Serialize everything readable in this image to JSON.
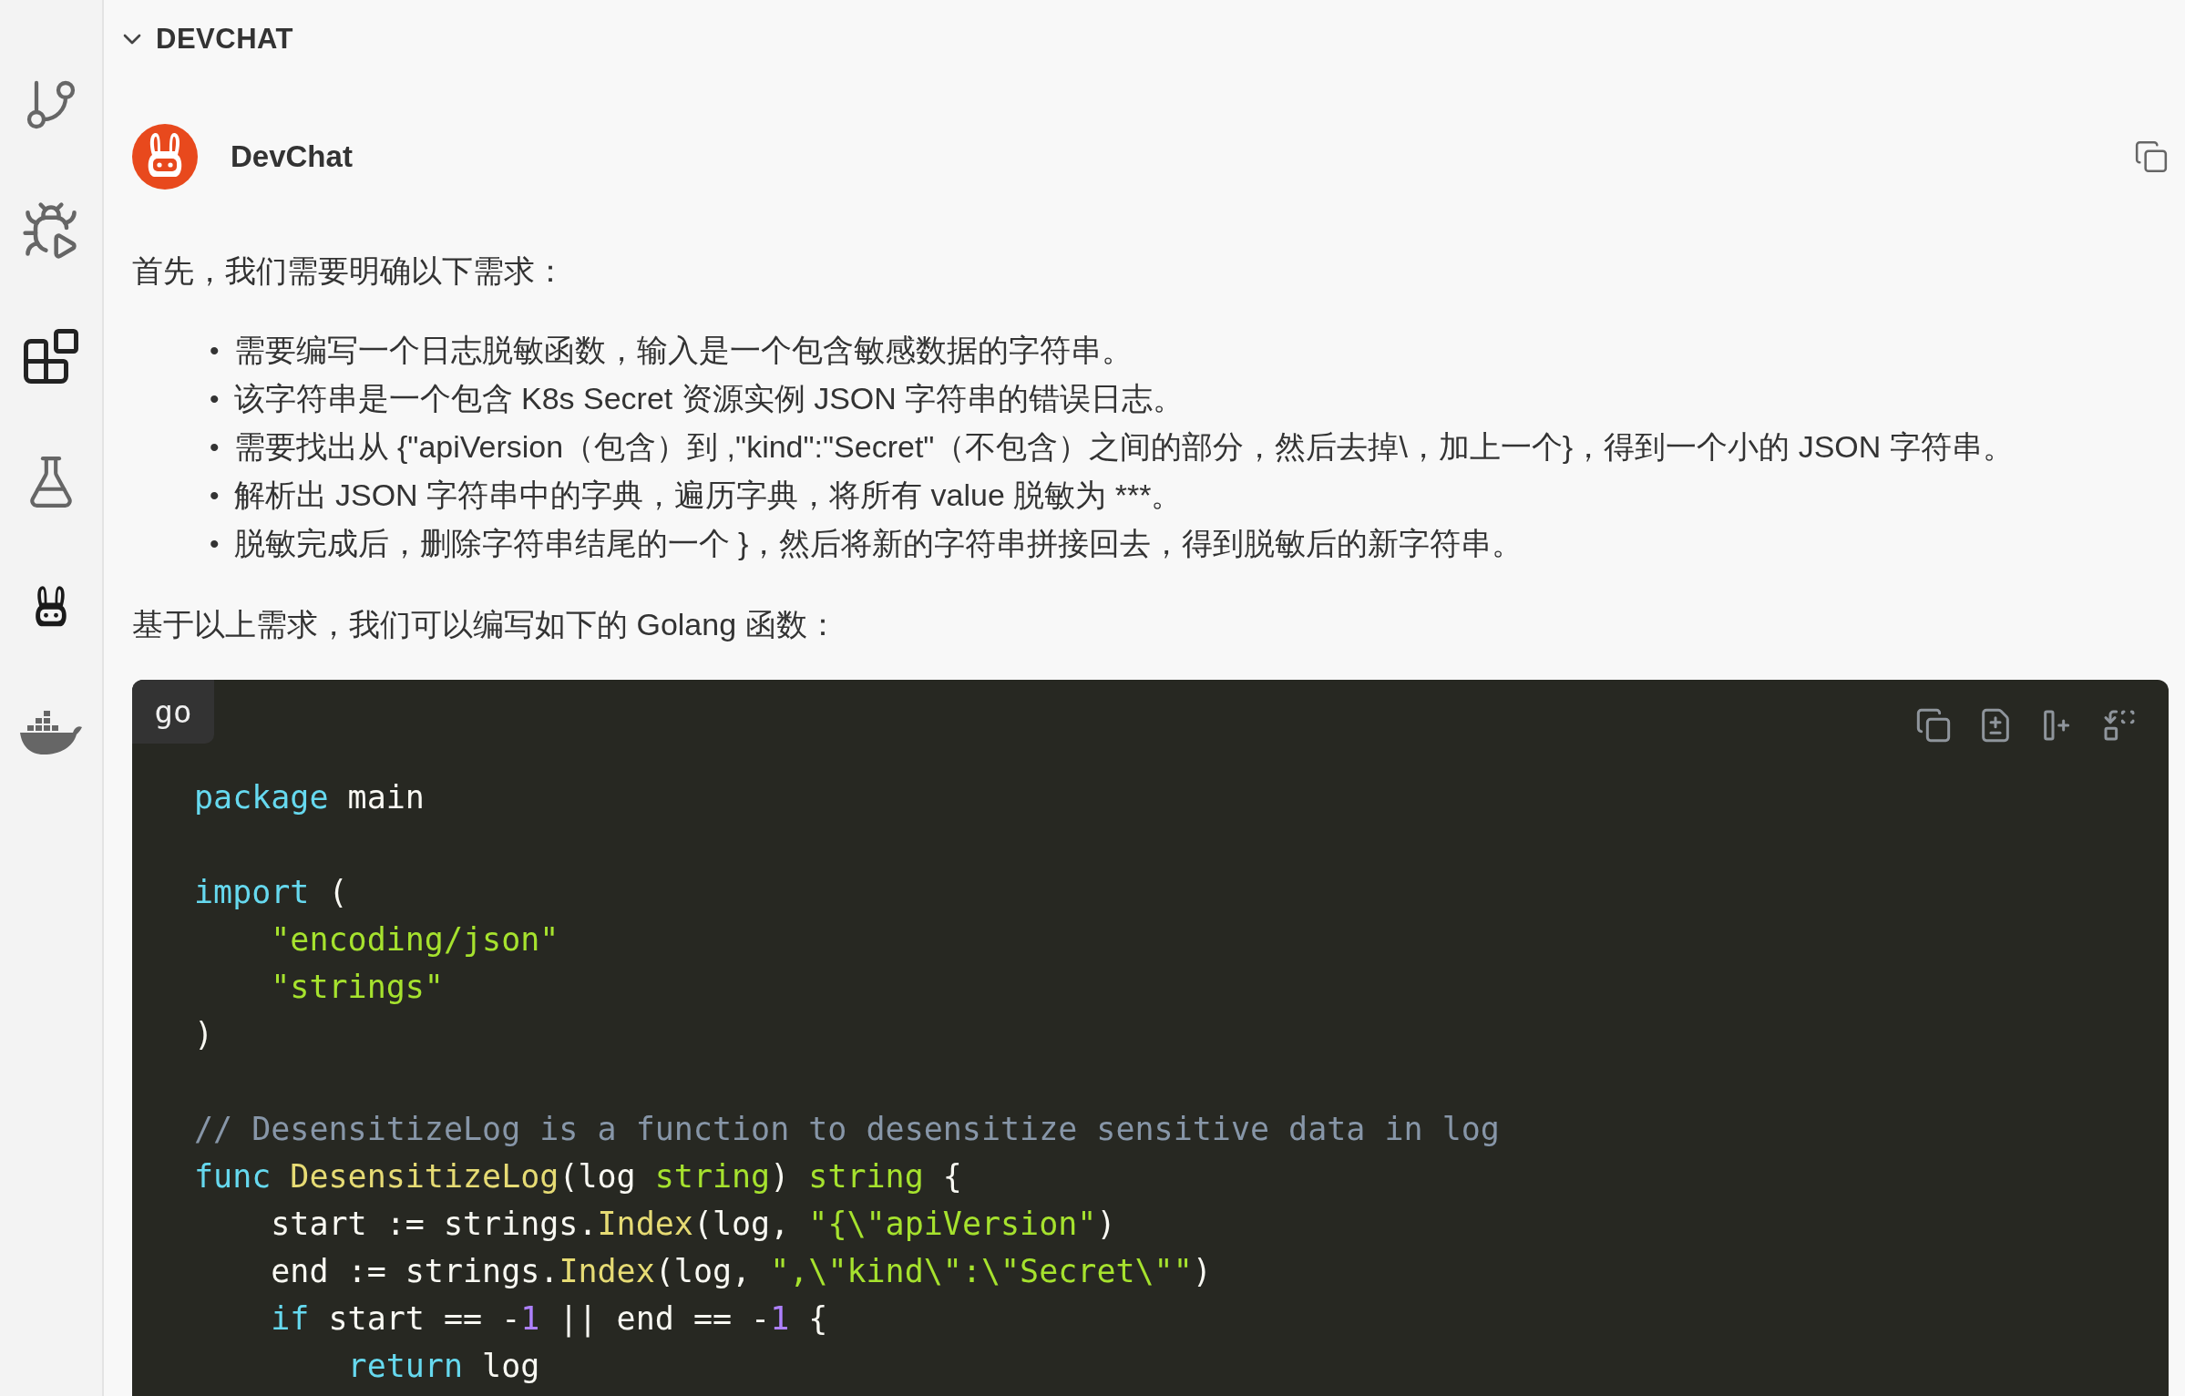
{
  "activity_bar": [
    {
      "kind": "branch"
    },
    {
      "kind": "debug"
    },
    {
      "kind": "extensions"
    },
    {
      "kind": "testing"
    },
    {
      "kind": "devchat"
    },
    {
      "kind": "docker"
    }
  ],
  "panel": {
    "title": "DEVCHAT",
    "expanded": true
  },
  "message": {
    "author": "DevChat",
    "intro": "首先，我们需要明确以下需求：",
    "bullets": [
      {
        "marker": "•",
        "text": "需要编写一个日志脱敏函数，输入是一个包含敏感数据的字符串。"
      },
      {
        "marker": "•",
        "text": "该字符串是一个包含 K8s Secret 资源实例 JSON 字符串的错误日志。"
      },
      {
        "marker": "•",
        "text": "需要找出从 {\"apiVersion（包含）到 ,\"kind\":\"Secret\"（不包含）之间的部分，然后去掉\\，加上一个}，得到一个小的 JSON 字符串。"
      },
      {
        "marker": "•",
        "text": "解析出 JSON 字符串中的字典，遍历字典，将所有 value 脱敏为 ***。"
      },
      {
        "marker": "•",
        "text": "脱敏完成后，删除字符串结尾的一个 }，然后将新的字符串拼接回去，得到脱敏后的新字符串。"
      }
    ],
    "outro": "基于以上需求，我们可以编写如下的 Golang 函数：",
    "code": {
      "language": "go",
      "lines": [
        {
          "kind": "code",
          "tokens": [
            {
              "kind": "keyword",
              "text": "package"
            },
            {
              "kind": "plain",
              "text": " main"
            }
          ]
        },
        {
          "kind": "blank"
        },
        {
          "kind": "code",
          "tokens": [
            {
              "kind": "keyword",
              "text": "import"
            },
            {
              "kind": "plain",
              "text": " ("
            }
          ]
        },
        {
          "kind": "code",
          "tokens": [
            {
              "kind": "string",
              "text": "    \"encoding/json\""
            }
          ]
        },
        {
          "kind": "code",
          "tokens": [
            {
              "kind": "string",
              "text": "    \"strings\""
            }
          ]
        },
        {
          "kind": "code",
          "tokens": [
            {
              "kind": "plain",
              "text": ")"
            }
          ]
        },
        {
          "kind": "blank"
        },
        {
          "kind": "code",
          "tokens": [
            {
              "kind": "comment",
              "text": "// DesensitizeLog is a function to desensitize sensitive data in log"
            }
          ]
        },
        {
          "kind": "code",
          "tokens": [
            {
              "kind": "keyword",
              "text": "func "
            },
            {
              "kind": "func",
              "text": "DesensitizeLog"
            },
            {
              "kind": "plain",
              "text": "(log "
            },
            {
              "kind": "type",
              "text": "string"
            },
            {
              "kind": "plain",
              "text": ") "
            },
            {
              "kind": "type",
              "text": "string"
            },
            {
              "kind": "plain",
              "text": " {"
            }
          ]
        },
        {
          "kind": "code",
          "tokens": [
            {
              "kind": "plain",
              "text": "    start := strings."
            },
            {
              "kind": "func",
              "text": "Index"
            },
            {
              "kind": "plain",
              "text": "(log, "
            },
            {
              "kind": "string",
              "text": "\"{\\\"apiVersion\""
            },
            {
              "kind": "plain",
              "text": ")"
            }
          ]
        },
        {
          "kind": "code",
          "tokens": [
            {
              "kind": "plain",
              "text": "    end := strings."
            },
            {
              "kind": "func",
              "text": "Index"
            },
            {
              "kind": "plain",
              "text": "(log, "
            },
            {
              "kind": "string",
              "text": "\",\\\"kind\\\":\\\"Secret\\\"\""
            },
            {
              "kind": "plain",
              "text": ")"
            }
          ]
        },
        {
          "kind": "code",
          "tokens": [
            {
              "kind": "keyword",
              "text": "    if"
            },
            {
              "kind": "plain",
              "text": " start == -"
            },
            {
              "kind": "number",
              "text": "1"
            },
            {
              "kind": "plain",
              "text": " || end == -"
            },
            {
              "kind": "number",
              "text": "1"
            },
            {
              "kind": "plain",
              "text": " {"
            }
          ]
        },
        {
          "kind": "code",
          "tokens": [
            {
              "kind": "keyword",
              "text": "        return"
            },
            {
              "kind": "plain",
              "text": " log"
            }
          ]
        }
      ]
    }
  }
}
